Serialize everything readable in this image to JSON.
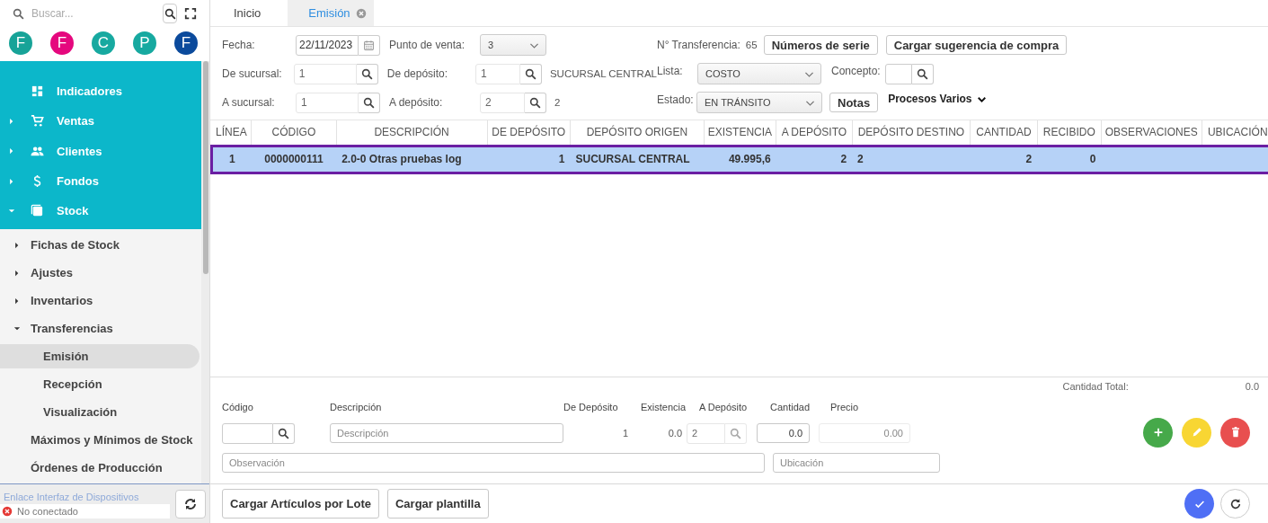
{
  "sidebar": {
    "search": {
      "placeholder": "Buscar..."
    },
    "shortcuts": [
      {
        "letter": "F",
        "color": "#17a398"
      },
      {
        "letter": "F",
        "color": "#e5087e"
      },
      {
        "letter": "C",
        "color": "#17a9a0"
      },
      {
        "letter": "P",
        "color": "#17a9a0"
      },
      {
        "letter": "F",
        "color": "#0b4a9c"
      }
    ],
    "menu": [
      {
        "label": "Indicadores",
        "kind": "link"
      },
      {
        "label": "Ventas",
        "kind": "group",
        "expanded": false
      },
      {
        "label": "Clientes",
        "kind": "group",
        "expanded": false
      },
      {
        "label": "Fondos",
        "kind": "group",
        "expanded": false
      },
      {
        "label": "Stock",
        "kind": "group",
        "expanded": true,
        "children": [
          {
            "label": "Fichas de Stock",
            "kind": "group",
            "expanded": false
          },
          {
            "label": "Ajustes",
            "kind": "group",
            "expanded": false
          },
          {
            "label": "Inventarios",
            "kind": "group",
            "expanded": false
          },
          {
            "label": "Transferencias",
            "kind": "group",
            "expanded": true,
            "children": [
              {
                "label": "Emisión",
                "selected": true
              },
              {
                "label": "Recepción",
                "selected": false
              },
              {
                "label": "Visualización",
                "selected": false
              }
            ]
          },
          {
            "label": "Máximos y Mínimos de Stock",
            "kind": "link",
            "selected": false
          },
          {
            "label": "Órdenes de Producción",
            "kind": "link",
            "selected": false
          }
        ]
      }
    ],
    "device_link": {
      "title": "Enlace Interfaz de Dispositivos",
      "status": "No conectado",
      "connected": false
    }
  },
  "tabs": [
    {
      "label": "Inicio",
      "selected": false,
      "closable": false
    },
    {
      "label": "Emisión",
      "selected": true,
      "closable": true
    }
  ],
  "form": {
    "fecha": {
      "label": "Fecha:",
      "value": "22/11/2023"
    },
    "punto_de_venta": {
      "label": "Punto de venta:",
      "value": "3"
    },
    "de_sucursal": {
      "label": "De sucursal:",
      "value": "1"
    },
    "de_deposito": {
      "label": "De depósito:",
      "value": "1",
      "name": "SUCURSAL CENTRAL"
    },
    "a_sucursal": {
      "label": "A sucursal:",
      "value": "1"
    },
    "a_deposito": {
      "label": "A depósito:",
      "value": "2",
      "name": "2"
    },
    "transferencia": {
      "label": "N° Transferencia:",
      "value": "65"
    },
    "buttons": [
      "Números de serie",
      "Cargar sugerencia de compra"
    ],
    "lista": {
      "label": "Lista:",
      "value": "COSTO"
    },
    "concepto": {
      "label": "Concepto:"
    },
    "estado": {
      "label": "Estado:",
      "value": "EN TRÁNSITO"
    },
    "notas": "Notas",
    "procesos": "Procesos Varios"
  },
  "table": {
    "columns": [
      "LÍNEA",
      "CÓDIGO",
      "DESCRIPCIÓN",
      "DE DEPÓSITO",
      "DEPÓSITO ORIGEN",
      "EXISTENCIA",
      "A DEPÓSITO",
      "DEPÓSITO DESTINO",
      "CANTIDAD",
      "RECIBIDO",
      "OBSERVACIONES",
      "UBICACIÓN"
    ],
    "rows": [
      {
        "selected": true,
        "cells": [
          "1",
          "0000000111",
          "2.0-0 Otras pruebas log",
          "1",
          "SUCURSAL CENTRAL",
          "49.995,6",
          "2",
          "2",
          "2",
          "0"
        ]
      }
    ]
  },
  "item_editor": {
    "total_label": "Cantidad Total:",
    "total": "0.0",
    "codigo": {
      "label": "Código"
    },
    "descripcion": {
      "label": "Descripción",
      "placeholder": "Descripción"
    },
    "de_deposito": {
      "label": "De Depósito",
      "value": "1"
    },
    "existencia": {
      "label": "Existencia",
      "value": "0.0"
    },
    "a_deposito": {
      "label": "A Depósito",
      "value": "2",
      "disabled": true
    },
    "cantidad": {
      "label": "Cantidad",
      "value": "0.0",
      "disabled": false
    },
    "precio": {
      "label": "Precio",
      "value": "0.00",
      "disabled": true
    },
    "observacion": {
      "placeholder": "Observación"
    },
    "ubicacion": {
      "placeholder": "Ubicación"
    }
  },
  "footer": {
    "buttons": [
      "Cargar Artículos por Lote",
      "Cargar plantilla"
    ]
  }
}
